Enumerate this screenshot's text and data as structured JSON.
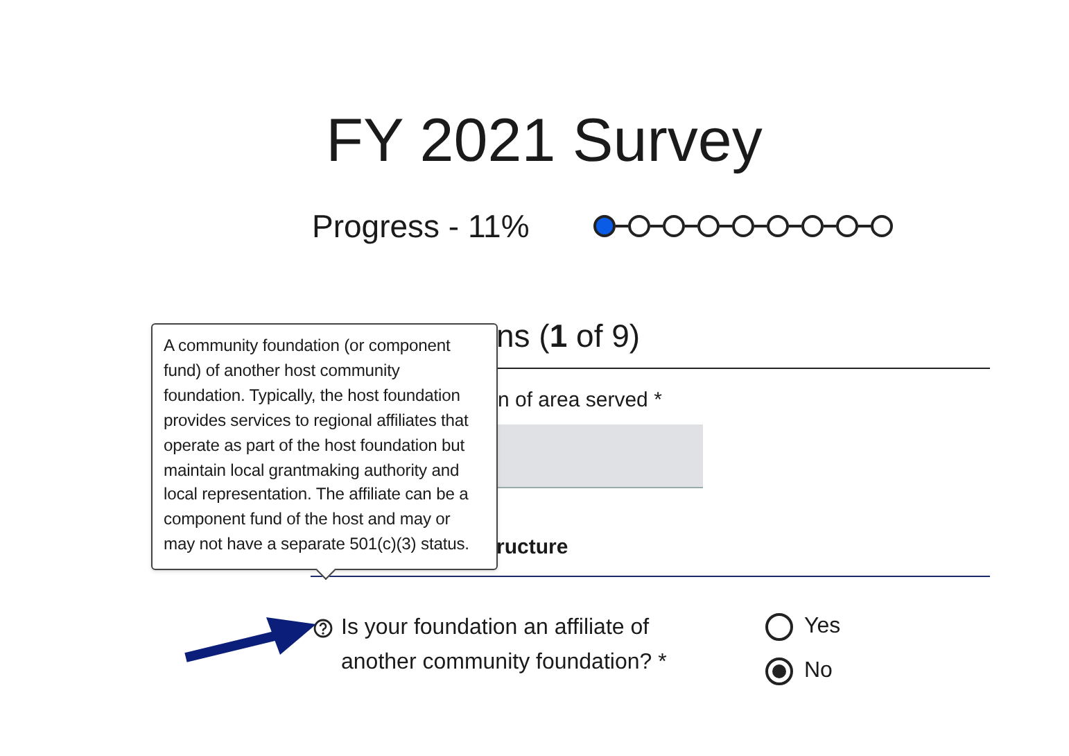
{
  "title": "FY 2021 Survey",
  "progress": {
    "label": "Progress - 11%",
    "steps": [
      {
        "selected": true
      },
      {
        "selected": false
      },
      {
        "selected": false
      },
      {
        "selected": false
      },
      {
        "selected": false
      },
      {
        "selected": false
      },
      {
        "selected": false
      },
      {
        "selected": false
      },
      {
        "selected": false
      }
    ]
  },
  "section_heading": "ns (**1** of 9)",
  "field": {
    "label": "n of area served *"
  },
  "subsection_heading": "ructure",
  "question": {
    "text": "Is your foundation an affiliate of another community foundation? *",
    "options": [
      {
        "label": "Yes",
        "selected": false
      },
      {
        "label": "No",
        "selected": true
      }
    ]
  },
  "tooltip": "A community foundation (or component fund) of another host community foundation. Typically, the host foundation provides services to regional affiliates that operate as part of the host foundation but maintain local grantmaking authority and local representation. The affiliate can be a component fund of the host and may or may not have a separate 501(c)(3) status."
}
